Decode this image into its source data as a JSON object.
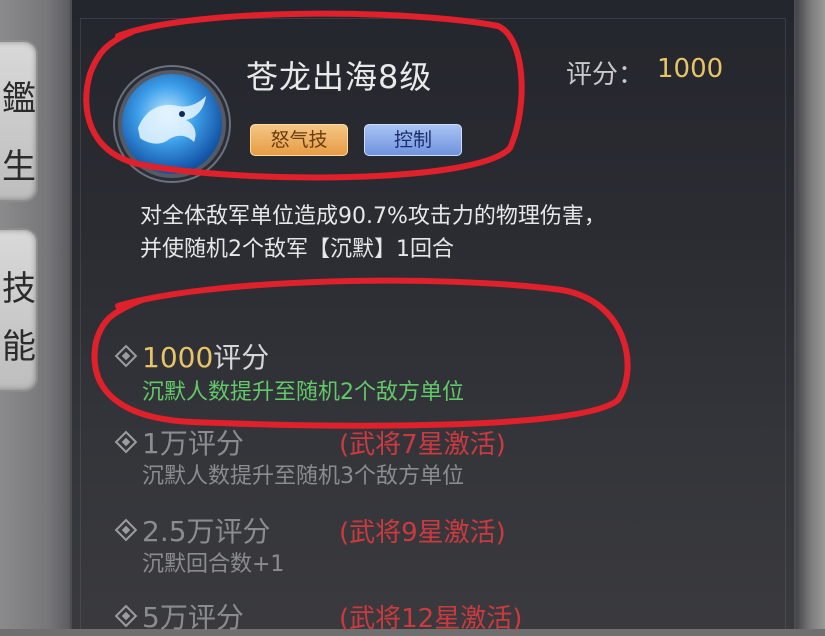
{
  "left_tabs": [
    {
      "chars": [
        "鑑",
        "生"
      ]
    },
    {
      "chars": [
        "技",
        "能"
      ]
    }
  ],
  "skill": {
    "name": "苍龙出海8级",
    "score_label": "评分：",
    "score_value": "1000",
    "tags": [
      "怒气技",
      "控制"
    ],
    "description": [
      "对全体敌军单位造成90.7%攻击力的物理伤害，",
      "并使随机2个敌军【沉默】1回合"
    ]
  },
  "upgrades": [
    {
      "score": "1000",
      "unit": "评分",
      "requirement": "",
      "effect": "沉默人数提升至随机2个敌方单位",
      "active": true
    },
    {
      "score": "1万",
      "unit": "评分",
      "requirement": "(武将7星激活)",
      "effect": "沉默人数提升至随机3个敌方单位",
      "active": false
    },
    {
      "score": "2.5万",
      "unit": "评分",
      "requirement": "(武将9星激活)",
      "effect": "沉默回合数+1",
      "active": false
    },
    {
      "score": "5万",
      "unit": "评分",
      "requirement": "(武将12星激活)",
      "effect": "",
      "active": false
    }
  ],
  "colors": {
    "gold": "#e8c466",
    "active_green": "#63c86a",
    "lock_red": "#cc3a3f",
    "annotation_red": "#e0202a"
  }
}
